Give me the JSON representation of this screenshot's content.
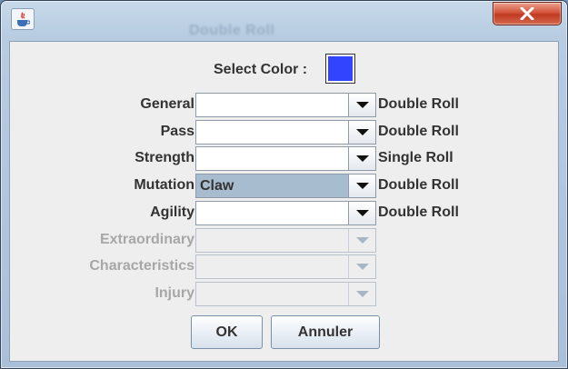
{
  "window": {
    "background_title_text": "Double Roll",
    "icon": "java-icon",
    "close_icon": "close-x-icon"
  },
  "color_picker": {
    "label": "Select Color :",
    "color": "#3344ff"
  },
  "rows": [
    {
      "label": "General",
      "value": "",
      "roll": "Double Roll",
      "enabled": true
    },
    {
      "label": "Pass",
      "value": "",
      "roll": "Double Roll",
      "enabled": true
    },
    {
      "label": "Strength",
      "value": "",
      "roll": "Single Roll",
      "enabled": true
    },
    {
      "label": "Mutation",
      "value": "Claw",
      "roll": "Double Roll",
      "enabled": true
    },
    {
      "label": "Agility",
      "value": "",
      "roll": "Double Roll",
      "enabled": true
    },
    {
      "label": "Extraordinary",
      "value": "",
      "roll": "",
      "enabled": false
    },
    {
      "label": "Characteristics",
      "value": "",
      "roll": "",
      "enabled": false
    },
    {
      "label": "Injury",
      "value": "",
      "roll": "",
      "enabled": false
    }
  ],
  "buttons": {
    "ok": "OK",
    "cancel": "Annuler"
  }
}
